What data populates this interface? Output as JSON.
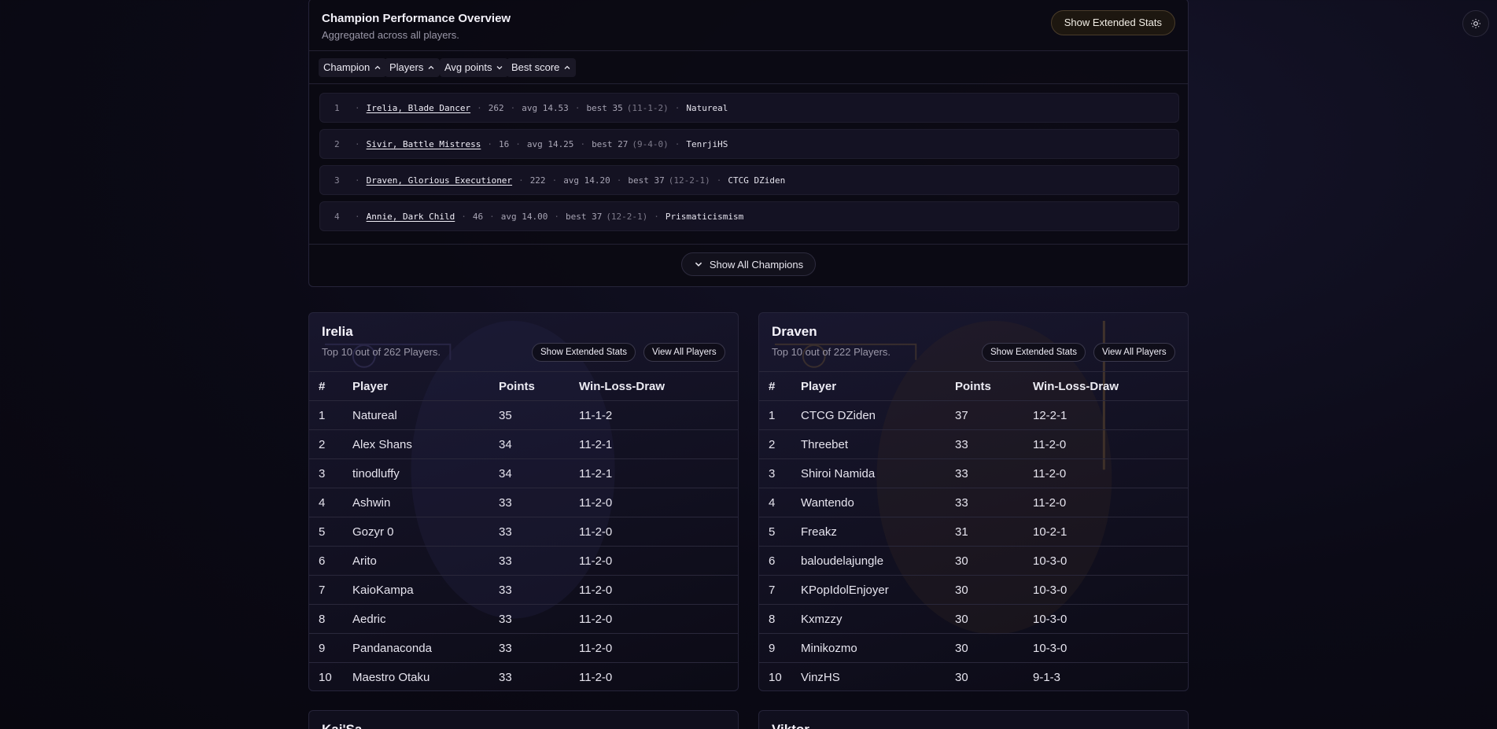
{
  "overview": {
    "title": "Champion Performance Overview",
    "subtitle": "Aggregated across all players.",
    "extended_stats_label": "Show Extended Stats",
    "sort_buttons": [
      "Champion",
      "Players",
      "Avg points",
      "Best score"
    ],
    "rows": [
      {
        "rank": "1",
        "champion": "Irelia, Blade Dancer",
        "players": "262",
        "avg": "avg 14.53",
        "best": "best 35",
        "record": "(11-1-2)",
        "player": "Natureal"
      },
      {
        "rank": "2",
        "champion": "Sivir, Battle Mistress",
        "players": "16",
        "avg": "avg 14.25",
        "best": "best 27",
        "record": "(9-4-0)",
        "player": "TenrjiHS"
      },
      {
        "rank": "3",
        "champion": "Draven, Glorious Executioner",
        "players": "222",
        "avg": "avg 14.20",
        "best": "best 37",
        "record": "(12-2-1)",
        "player": "CTCG DZiden"
      },
      {
        "rank": "4",
        "champion": "Annie, Dark Child",
        "players": "46",
        "avg": "avg 14.00",
        "best": "best 37",
        "record": "(12-2-1)",
        "player": "Prismaticismism"
      }
    ],
    "show_all_label": "Show All Champions"
  },
  "cards": [
    {
      "name": "Irelia",
      "subtitle": "Top 10 out of 262 Players.",
      "extended_label": "Show Extended Stats",
      "view_all_label": "View All Players",
      "headers": [
        "#",
        "Player",
        "Points",
        "Win-Loss-Draw"
      ],
      "rows": [
        [
          "1",
          "Natureal",
          "35",
          "11-1-2"
        ],
        [
          "2",
          "Alex Shans",
          "34",
          "11-2-1"
        ],
        [
          "3",
          "tinodluffy",
          "34",
          "11-2-1"
        ],
        [
          "4",
          "Ashwin",
          "33",
          "11-2-0"
        ],
        [
          "5",
          "Gozyr 0",
          "33",
          "11-2-0"
        ],
        [
          "6",
          "Arito",
          "33",
          "11-2-0"
        ],
        [
          "7",
          "KaioKampa",
          "33",
          "11-2-0"
        ],
        [
          "8",
          "Aedric",
          "33",
          "11-2-0"
        ],
        [
          "9",
          "Pandanaconda",
          "33",
          "11-2-0"
        ],
        [
          "10",
          "Maestro Otaku",
          "33",
          "11-2-0"
        ]
      ]
    },
    {
      "name": "Draven",
      "subtitle": "Top 10 out of 222 Players.",
      "extended_label": "Show Extended Stats",
      "view_all_label": "View All Players",
      "headers": [
        "#",
        "Player",
        "Points",
        "Win-Loss-Draw"
      ],
      "rows": [
        [
          "1",
          "CTCG DZiden",
          "37",
          "12-2-1"
        ],
        [
          "2",
          "Threebet",
          "33",
          "11-2-0"
        ],
        [
          "3",
          "Shiroi Namida",
          "33",
          "11-2-0"
        ],
        [
          "4",
          "Wantendo",
          "33",
          "11-2-0"
        ],
        [
          "5",
          "Freakz",
          "31",
          "10-2-1"
        ],
        [
          "6",
          "baloudelajungle",
          "30",
          "10-3-0"
        ],
        [
          "7",
          "KPopIdolEnjoyer",
          "30",
          "10-3-0"
        ],
        [
          "8",
          "Kxmzzy",
          "30",
          "10-3-0"
        ],
        [
          "9",
          "Minikozmo",
          "30",
          "10-3-0"
        ],
        [
          "10",
          "VinzHS",
          "30",
          "9-1-3"
        ]
      ]
    }
  ],
  "next_cards": [
    {
      "name": "Kai'Sa"
    },
    {
      "name": "Viktor"
    }
  ],
  "icons": {
    "theme": "sun-icon",
    "sort": "chevron-up-icon",
    "sort_desc": "chevron-down-icon",
    "expand": "chevron-down-icon"
  }
}
